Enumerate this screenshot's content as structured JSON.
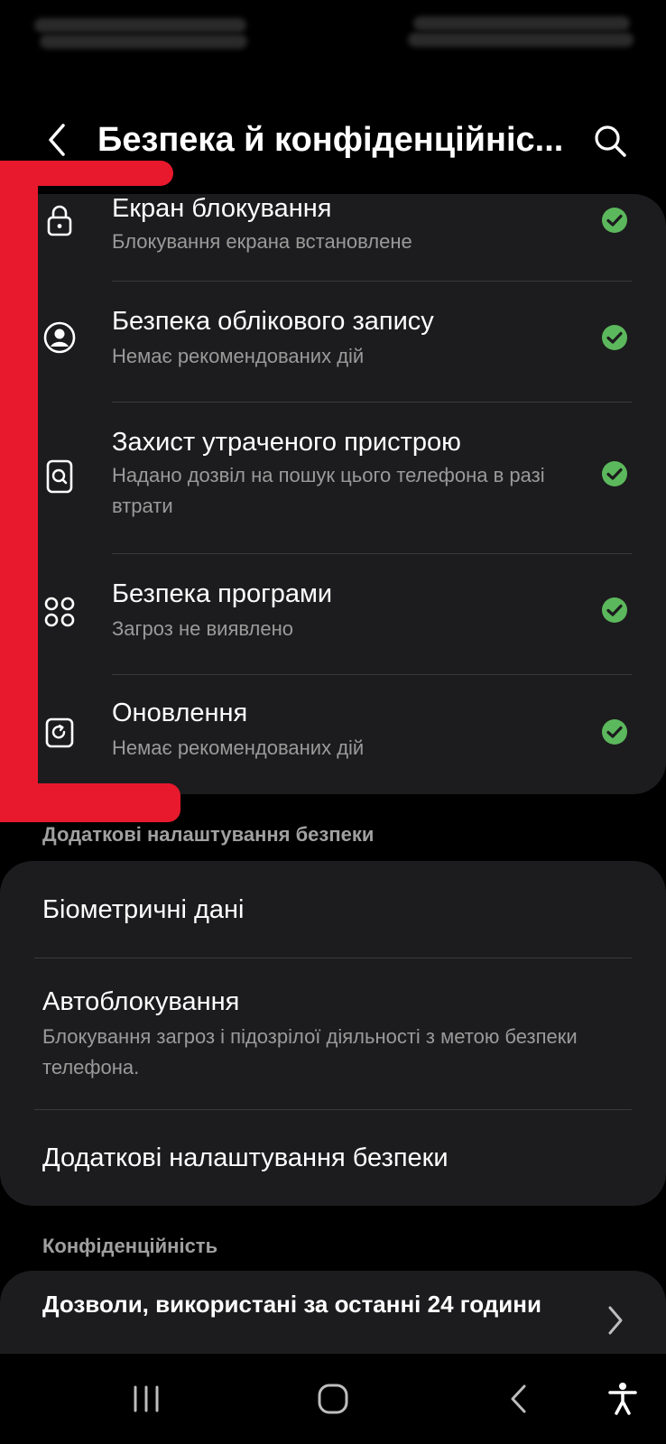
{
  "header": {
    "title": "Безпека й конфіденційніс...",
    "back_icon": "chevron-left-icon",
    "search_icon": "search-icon"
  },
  "security_items": [
    {
      "title": "Екран блокування",
      "subtitle": "Блокування екрана встановлене",
      "icon": "lock-icon",
      "status_icon": "check-circle-icon"
    },
    {
      "title": "Безпека облікового запису",
      "subtitle": "Немає рекомендованих дій",
      "icon": "account-circle-icon",
      "status_icon": "check-circle-icon"
    },
    {
      "title": "Захист утраченого пристрою",
      "subtitle": "Надано дозвіл на пошук цього телефона в разі втрати",
      "icon": "find-device-icon",
      "status_icon": "check-circle-icon"
    },
    {
      "title": "Безпека програми",
      "subtitle": "Загроз не виявлено",
      "icon": "apps-grid-icon",
      "status_icon": "check-circle-icon"
    },
    {
      "title": "Оновлення",
      "subtitle": "Немає рекомендованих дій",
      "icon": "update-icon",
      "status_icon": "check-circle-icon"
    }
  ],
  "additional": {
    "header": "Додаткові налаштування безпеки",
    "items": [
      {
        "title": "Біометричні дані"
      },
      {
        "title": "Автоблокування",
        "subtitle": "Блокування загроз і підозрілої діяльності з метою безпеки телефона."
      },
      {
        "title": "Додаткові налаштування безпеки"
      }
    ]
  },
  "privacy": {
    "header": "Конфіденційність",
    "items": [
      {
        "title": "Дозволи, використані за останні 24 години"
      }
    ]
  },
  "nav": {
    "recents_icon": "recents-icon",
    "home_icon": "home-icon",
    "back_icon": "back-icon",
    "accessibility_icon": "accessibility-icon"
  },
  "colors": {
    "background": "#000000",
    "card": "#1c1c1e",
    "check": "#5cb85c",
    "annotation": "#e8192c",
    "subtitle": "#9a9a9a"
  }
}
